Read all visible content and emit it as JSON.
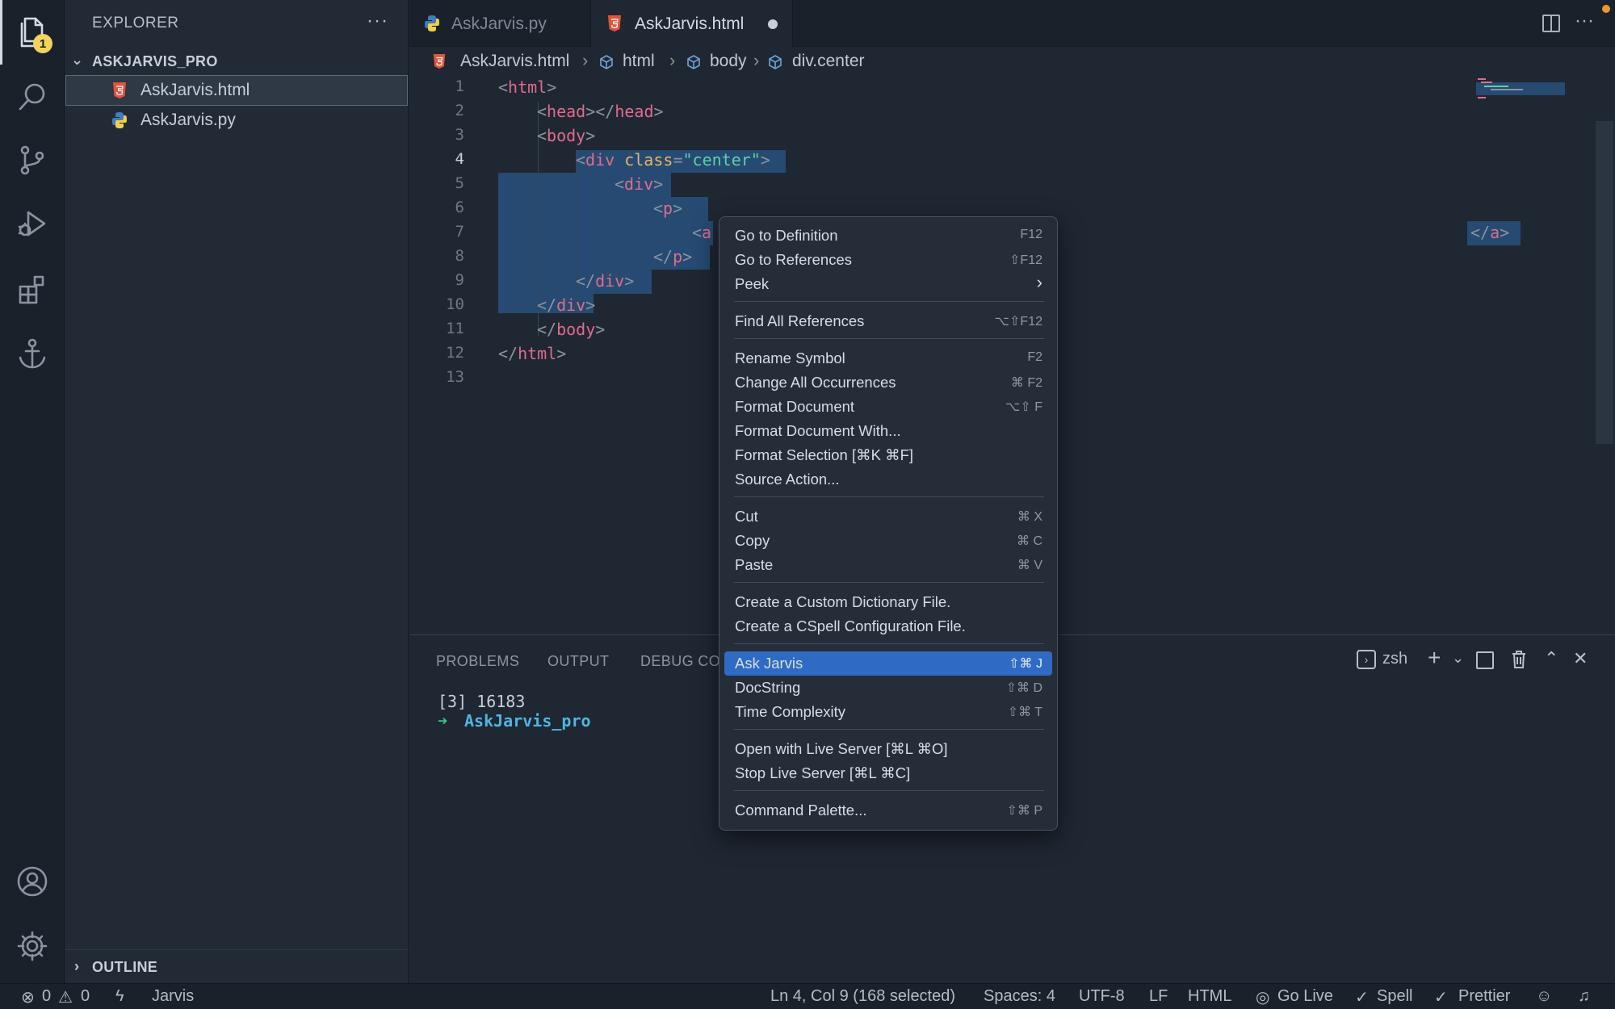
{
  "activity_bar": {
    "explorer_badge": "1"
  },
  "sidebar": {
    "title": "EXPLORER",
    "more": "···",
    "root_folder": "ASKJARVIS_PRO",
    "files": [
      {
        "name": "AskJarvis.html",
        "icon": "html5-icon",
        "selected": true
      },
      {
        "name": "AskJarvis.py",
        "icon": "python-icon",
        "selected": false
      }
    ],
    "outline": "OUTLINE"
  },
  "tabs": [
    {
      "label": "AskJarvis.py",
      "active": false
    },
    {
      "label": "AskJarvis.html",
      "active": true,
      "dirty": true
    }
  ],
  "breadcrumb": [
    "AskJarvis.html",
    "html",
    "body",
    "div.center"
  ],
  "editor": {
    "current_line": 4,
    "line_numbers": [
      "1",
      "2",
      "3",
      "4",
      "5",
      "6",
      "7",
      "8",
      "9",
      "10",
      "11",
      "12",
      "13"
    ]
  },
  "panel": {
    "tabs": [
      "PROBLEMS",
      "OUTPUT",
      "DEBUG CONSOLE"
    ],
    "terminal_lines": [
      "[3] 16183",
      "AskJarvis_pro"
    ],
    "prompt_arrow": "➜",
    "shell_name": "zsh"
  },
  "context_menu": {
    "items": [
      {
        "label": "Go to Definition",
        "shortcut": "F12"
      },
      {
        "label": "Go to References",
        "shortcut": "⇧F12"
      },
      {
        "label": "Peek",
        "shortcut": "›"
      },
      {
        "label": "Find All References",
        "shortcut": "⌥⇧F12"
      },
      {
        "label": "Rename Symbol",
        "shortcut": "F2"
      },
      {
        "label": "Change All Occurrences",
        "shortcut": "⌘ F2"
      },
      {
        "label": "Format Document",
        "shortcut": "⌥⇧ F"
      },
      {
        "label": "Format Document With...",
        "shortcut": ""
      },
      {
        "label": "Format Selection [⌘K ⌘F]",
        "shortcut": ""
      },
      {
        "label": "Source Action...",
        "shortcut": ""
      },
      {
        "label": "Cut",
        "shortcut": "⌘ X"
      },
      {
        "label": "Copy",
        "shortcut": "⌘ C"
      },
      {
        "label": "Paste",
        "shortcut": "⌘ V"
      },
      {
        "label": "Create a Custom Dictionary File.",
        "shortcut": ""
      },
      {
        "label": "Create a CSpell Configuration File.",
        "shortcut": ""
      },
      {
        "label": "Ask Jarvis",
        "shortcut": "⇧⌘ J",
        "highlighted": true
      },
      {
        "label": "DocString",
        "shortcut": "⇧⌘ D"
      },
      {
        "label": "Time Complexity",
        "shortcut": "⇧⌘ T"
      },
      {
        "label": "Open with Live Server [⌘L ⌘O]",
        "shortcut": ""
      },
      {
        "label": "Stop Live Server [⌘L ⌘C]",
        "shortcut": ""
      },
      {
        "label": "Command Palette...",
        "shortcut": "⇧⌘ P"
      }
    ]
  },
  "status_bar": {
    "errors": "0",
    "warnings": "0",
    "extension": "Jarvis",
    "cursor": "Ln 4, Col 9 (168 selected)",
    "spaces": "Spaces: 4",
    "encoding": "UTF-8",
    "eol": "LF",
    "language": "HTML",
    "go_live": "Go Live",
    "spell": "Spell",
    "prettier": "Prettier"
  },
  "colors": {
    "accent": "#2f6bc4",
    "tag": "#e06c8a",
    "attribute": "#e5b567",
    "string": "#5fd0a8",
    "selection": "#264a72",
    "badge": "#f2d35b"
  }
}
